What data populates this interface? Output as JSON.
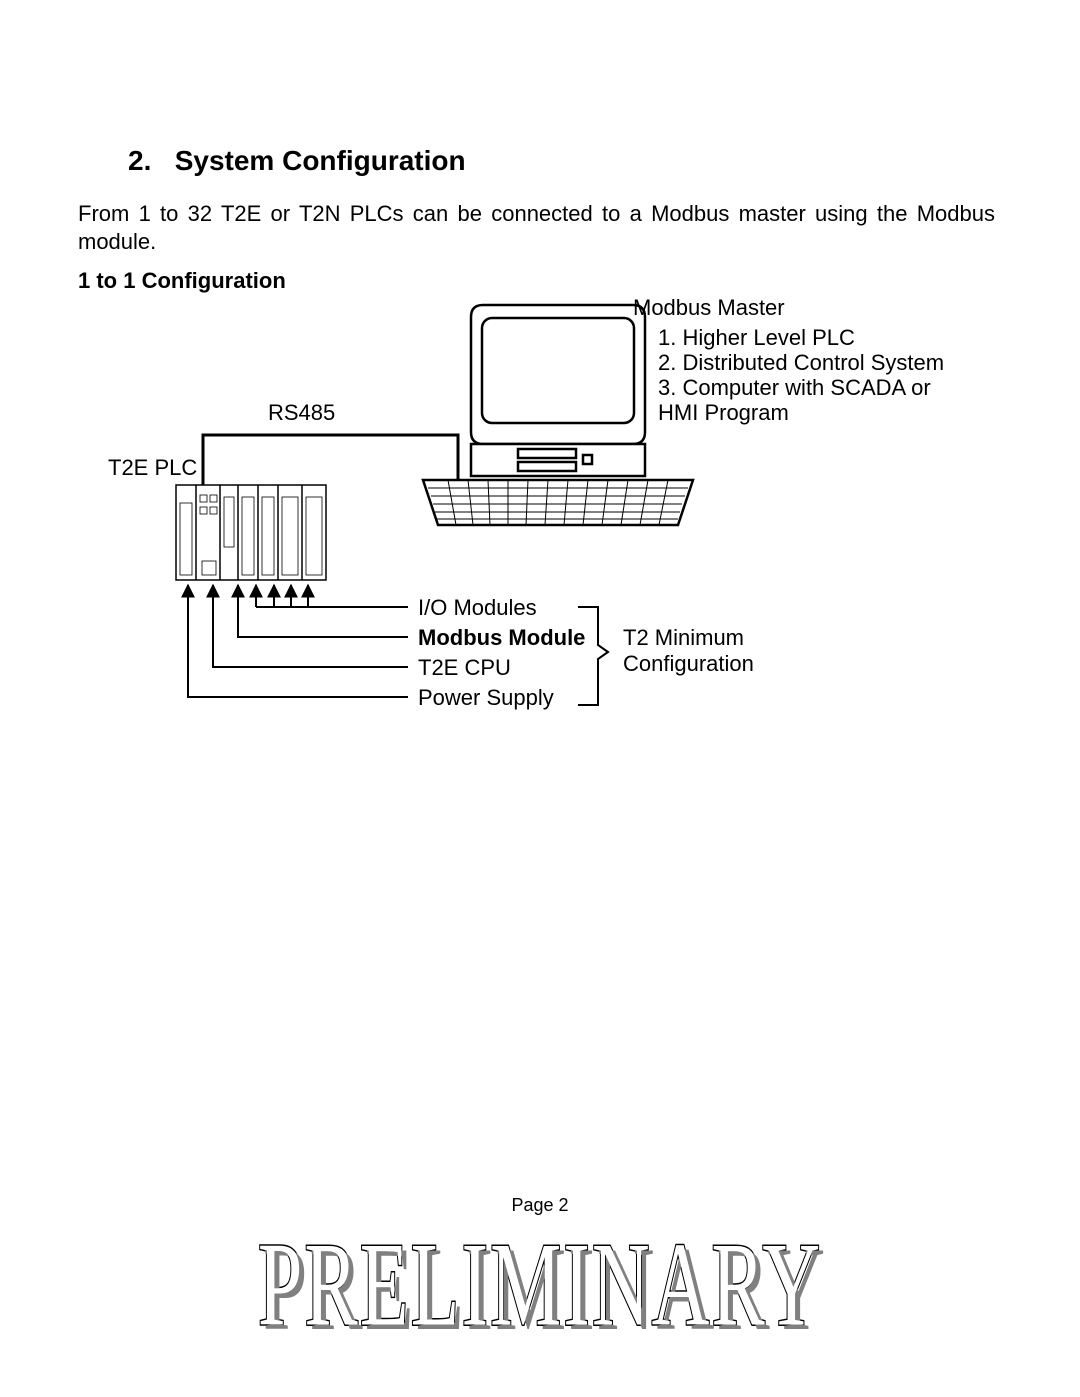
{
  "section": {
    "number": "2.",
    "title": "System Configuration"
  },
  "intro_text": "From 1 to 32 T2E or T2N PLCs can be connected to a Modbus master using the Modbus module.",
  "config_heading": "1 to 1 Configuration",
  "diagram": {
    "rs485_label": "RS485",
    "plc_label": "T2E PLC",
    "master_title": "Modbus Master",
    "master_list": [
      "1.  Higher Level PLC",
      "2. Distributed Control System",
      "3. Computer with SCADA or",
      "    HMI Program"
    ],
    "callouts": {
      "io_modules": "I/O Modules",
      "modbus_module": "Modbus Module",
      "t2e_cpu": "T2E CPU",
      "power_supply": "Power Supply"
    },
    "group_label_line1": "T2 Minimum",
    "group_label_line2": "Configuration"
  },
  "footer": {
    "page_label": "Page  2",
    "watermark": "PRELIMINARY"
  }
}
